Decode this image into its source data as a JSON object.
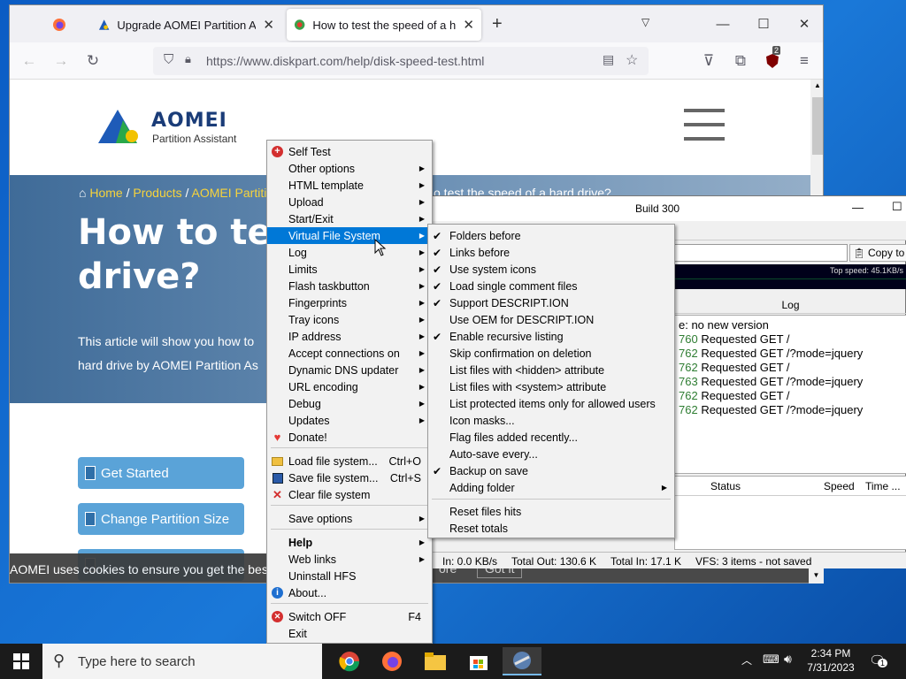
{
  "browser": {
    "tabs": [
      {
        "title": ""
      },
      {
        "title": "Upgrade AOMEI Partition Assistant"
      },
      {
        "title": "How to test the speed of a hard drive"
      }
    ],
    "url": "https://www.diskpart.com/help/disk-speed-test.html",
    "extension_badge": "2"
  },
  "page": {
    "logo_name": "AOMEI",
    "logo_sub": "Partition Assistant",
    "breadcrumb": {
      "home": "Home",
      "sep": "/",
      "products": "Products",
      "partition": "AOMEI Partiti",
      "rest": "o test the speed of a hard drive?"
    },
    "title": "How to te drive?",
    "lede": "This article will show you how to hard drive by AOMEI Partition As",
    "buttons": [
      "Get Started",
      "Change Partition Size",
      ""
    ],
    "cookie_text": "AOMEI uses cookies to ensure you get the best exp",
    "cookie_more": "ore",
    "cookie_got": "Got it"
  },
  "hfs": {
    "title": "Build 300",
    "copy_button": "Copy to",
    "top_speed": "Top speed: 45.1KB/s",
    "log_header": "Log",
    "log_lines": [
      {
        "id": "",
        "text": "e: no new version"
      },
      {
        "id": "760",
        "text": " Requested GET /"
      },
      {
        "id": "762",
        "text": " Requested GET /?mode=jquery"
      },
      {
        "id": "762",
        "text": " Requested GET /"
      },
      {
        "id": "763",
        "text": " Requested GET /?mode=jquery"
      },
      {
        "id": "762",
        "text": " Requested GET /"
      },
      {
        "id": "762",
        "text": " Requested GET /?mode=jquery"
      }
    ],
    "columns": {
      "status": "Status",
      "speed": "Speed",
      "time": "Time ..."
    },
    "status": {
      "in": "In: 0.0 KB/s",
      "total_out": "Total Out: 130.6 K",
      "total_in": "Total In: 17.1 K",
      "vfs": "VFS: 3 items - not saved"
    }
  },
  "main_menu": [
    {
      "label": "Self Test",
      "icon": "plus-red-icon"
    },
    {
      "label": "Other options",
      "sub": true
    },
    {
      "label": "HTML template",
      "sub": true
    },
    {
      "label": "Upload",
      "sub": true
    },
    {
      "label": "Start/Exit",
      "sub": true
    },
    {
      "label": "Virtual File System",
      "sub": true,
      "highlight": true
    },
    {
      "label": "Log",
      "sub": true
    },
    {
      "label": "Limits",
      "sub": true
    },
    {
      "label": "Flash taskbutton",
      "sub": true
    },
    {
      "label": "Fingerprints",
      "sub": true
    },
    {
      "label": "Tray icons",
      "sub": true
    },
    {
      "label": "IP address",
      "sub": true
    },
    {
      "label": "Accept connections on",
      "sub": true
    },
    {
      "label": "Dynamic DNS updater",
      "sub": true
    },
    {
      "label": "URL encoding",
      "sub": true
    },
    {
      "label": "Debug",
      "sub": true
    },
    {
      "label": "Updates",
      "sub": true
    },
    {
      "label": "Donate!",
      "icon": "heart-icon"
    },
    {
      "label": "Load file system...",
      "shortcut": "Ctrl+O",
      "icon": "folder-icon"
    },
    {
      "label": "Save file system...",
      "shortcut": "Ctrl+S",
      "icon": "floppy-icon"
    },
    {
      "label": "Clear file system",
      "icon": "red-x-icon"
    },
    {
      "label": "Save options",
      "sub": true
    },
    {
      "label": "Help",
      "sub": true,
      "bold": true
    },
    {
      "label": "Web links",
      "sub": true
    },
    {
      "label": "Uninstall HFS"
    },
    {
      "label": "About...",
      "icon": "info-icon"
    },
    {
      "label": "Switch OFF",
      "shortcut": "F4",
      "icon": "power-off-icon"
    },
    {
      "label": "Exit"
    }
  ],
  "vfs_menu": [
    {
      "label": "Folders before",
      "checked": true
    },
    {
      "label": "Links before",
      "checked": true
    },
    {
      "label": "Use system icons",
      "checked": true
    },
    {
      "label": "Load single comment files",
      "checked": true
    },
    {
      "label": "Support DESCRIPT.ION",
      "checked": true
    },
    {
      "label": "Use OEM for DESCRIPT.ION",
      "checked": false
    },
    {
      "label": "Enable recursive listing",
      "checked": true
    },
    {
      "label": "Skip confirmation on deletion",
      "checked": false
    },
    {
      "label": "List files with <hidden> attribute",
      "checked": false
    },
    {
      "label": "List files with <system> attribute",
      "checked": false
    },
    {
      "label": "List protected items only for allowed users",
      "checked": false
    },
    {
      "label": "Icon masks...",
      "checked": false
    },
    {
      "label": "Flag files added recently...",
      "checked": false
    },
    {
      "label": "Auto-save every...",
      "checked": false
    },
    {
      "label": "Backup on save",
      "checked": true
    },
    {
      "label": "Adding folder",
      "checked": false,
      "sub": true
    },
    {
      "label": "Reset files hits",
      "checked": false
    },
    {
      "label": "Reset totals",
      "checked": false
    }
  ],
  "taskbar": {
    "search_placeholder": "Type here to search",
    "time": "2:34 PM",
    "date": "7/31/2023",
    "notification_count": "1"
  },
  "colors": {
    "menu_highlight": "#0078d7",
    "hero": "#4f7aa6",
    "crumb_link": "#f6d33c"
  }
}
